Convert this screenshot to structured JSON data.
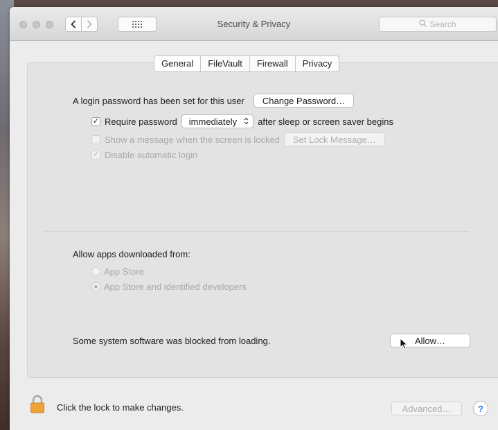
{
  "window": {
    "title": "Security & Privacy",
    "search_placeholder": "Search"
  },
  "tabs": [
    {
      "label": "General",
      "selected": true
    },
    {
      "label": "FileVault",
      "selected": false
    },
    {
      "label": "Firewall",
      "selected": false
    },
    {
      "label": "Privacy",
      "selected": false
    }
  ],
  "general": {
    "login_password_text": "A login password has been set for this user",
    "change_password_label": "Change Password…",
    "require_password": {
      "checked": true,
      "label": "Require password",
      "popup_value": "immediately",
      "suffix": "after sleep or screen saver begins"
    },
    "show_message": {
      "checked": false,
      "enabled": false,
      "label": "Show a message when the screen is locked",
      "button_label": "Set Lock Message…"
    },
    "disable_auto_login": {
      "checked": true,
      "enabled": false,
      "label": "Disable automatic login"
    }
  },
  "downloads": {
    "heading": "Allow apps downloaded from:",
    "options": [
      {
        "label": "App Store",
        "selected": false
      },
      {
        "label": "App Store and identified developers",
        "selected": true
      }
    ]
  },
  "blocked": {
    "text": "Some system software was blocked from loading.",
    "allow_label": "Allow…"
  },
  "footer": {
    "lock_text": "Click the lock to make changes.",
    "advanced_label": "Advanced…",
    "help_label": "?"
  },
  "icons": [
    "chevron-left-icon",
    "chevron-right-icon",
    "grid-icon",
    "search-icon",
    "lock-icon",
    "checkmark-icon",
    "popup-arrows-icon",
    "cursor-icon"
  ]
}
